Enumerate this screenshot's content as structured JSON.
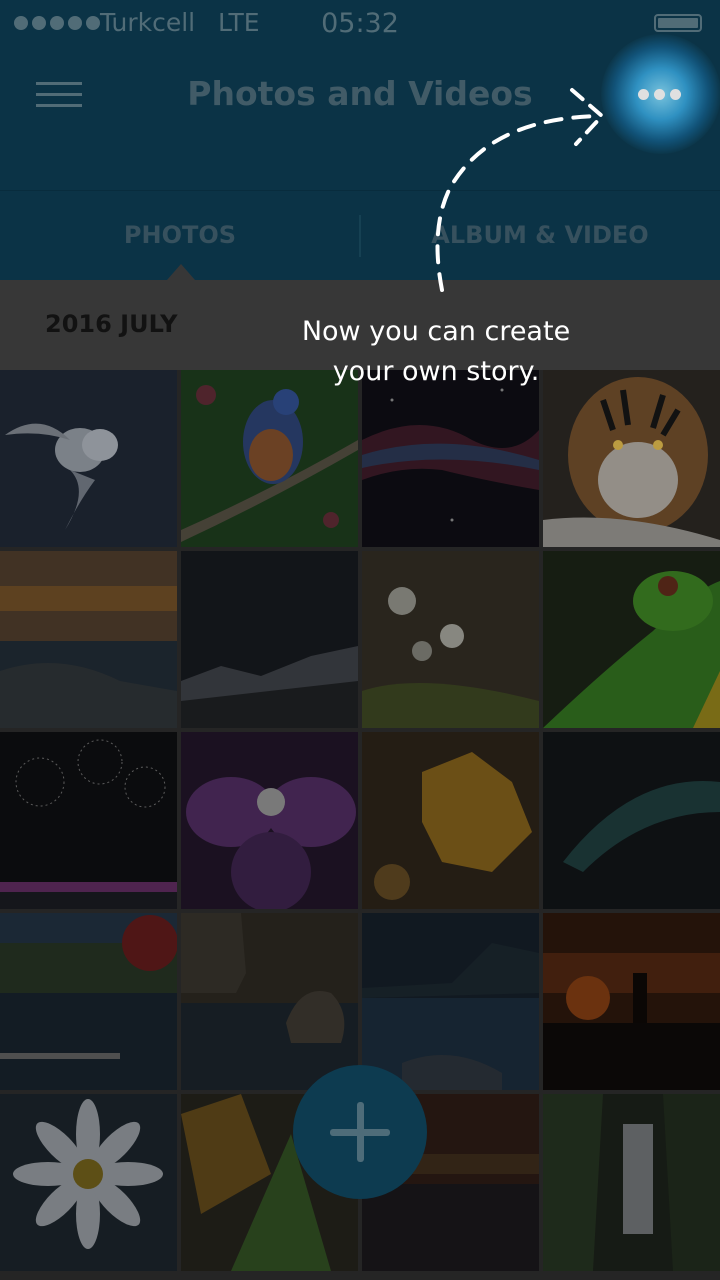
{
  "status_bar": {
    "carrier": "Turkcell",
    "network": "LTE",
    "time": "05:32",
    "signal_icon": "signal-dots-icon",
    "battery_icon": "battery-full-icon"
  },
  "header": {
    "title": "Photos and Videos",
    "menu_icon": "hamburger-menu-icon",
    "more_icon": "more-options-icon"
  },
  "tabs": [
    {
      "label": "PHOTOS",
      "selected": true
    },
    {
      "label": "ALBUM & VIDEO",
      "selected": false
    }
  ],
  "section": {
    "title": "2016 JULY"
  },
  "coachmark": {
    "line1": "Now you can create",
    "line2": "your own story."
  },
  "fab": {
    "icon": "plus-icon"
  },
  "colors": {
    "header_bg": "#0d3b50",
    "overlay": "#3f3f3f",
    "glow": "#3cb4f0",
    "coach_text": "#ffffff"
  }
}
